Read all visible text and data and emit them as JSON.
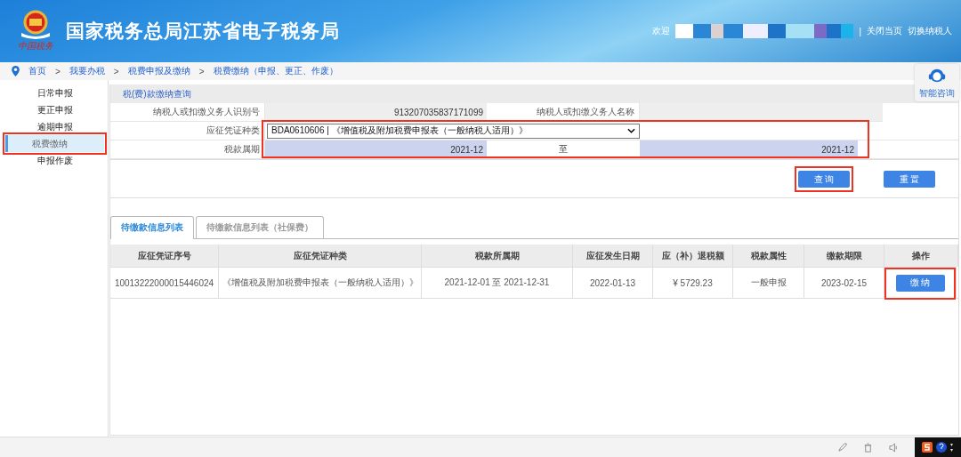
{
  "header": {
    "title": "国家税务总局江苏省电子税务局",
    "logo_caption": "中国税务",
    "welcome": "欢迎",
    "separator": "|",
    "links": [
      "关闭当页",
      "切换纳税人"
    ]
  },
  "breadcrumb": [
    "首页",
    ">",
    "我要办税",
    ">",
    "税费申报及缴纳",
    ">",
    "税费缴纳（申报、更正、作废）"
  ],
  "sidebar": {
    "items": [
      {
        "label": "日常申报",
        "selected": false,
        "highlighted": false
      },
      {
        "label": "更正申报",
        "selected": false,
        "highlighted": false
      },
      {
        "label": "逾期申报",
        "selected": false,
        "highlighted": false
      },
      {
        "label": "税费缴纳",
        "selected": true,
        "highlighted": true
      },
      {
        "label": "申报作废",
        "selected": false,
        "highlighted": false
      }
    ]
  },
  "assistant": {
    "label": "智能咨询"
  },
  "query": {
    "title": "税(费)款缴纳查询",
    "taxpayer_id_label": "纳税人或扣缴义务人识别号",
    "taxpayer_id": "913207035837171099",
    "taxpayer_name_label": "纳税人或扣缴义务人名称",
    "voucher_type_label": "应征凭证种类",
    "voucher_type": "BDA0610606 | 《增值税及附加税费申报表（一般纳税人适用）》",
    "period_label": "税款属期",
    "period_from": "2021-12",
    "period_to_label": "至",
    "period_to": "2021-12",
    "fields_highlighted": true,
    "buttons": [
      {
        "label": "查 询",
        "highlighted": true
      },
      {
        "label": "重 置",
        "highlighted": false
      }
    ]
  },
  "tabs": [
    {
      "label": "待缴款信息列表",
      "selected": true
    },
    {
      "label": "待缴款信息列表（社保费）",
      "selected": false
    }
  ],
  "table": {
    "columns": [
      "应征凭证序号",
      "应征凭证种类",
      "税款所属期",
      "应征发生日期",
      "应（补）退税额",
      "税款属性",
      "缴款期限",
      "操作"
    ],
    "rows": [
      {
        "cells": [
          "10013222000015446024",
          "《增值税及附加税费申报表（一般纳税人适用）》",
          "2021-12-01 至 2021-12-31",
          "2022-01-13",
          "¥ 5729.23",
          "一般申报",
          "2023-02-15"
        ],
        "action": "缴 纳",
        "action_highlighted": true
      }
    ]
  }
}
